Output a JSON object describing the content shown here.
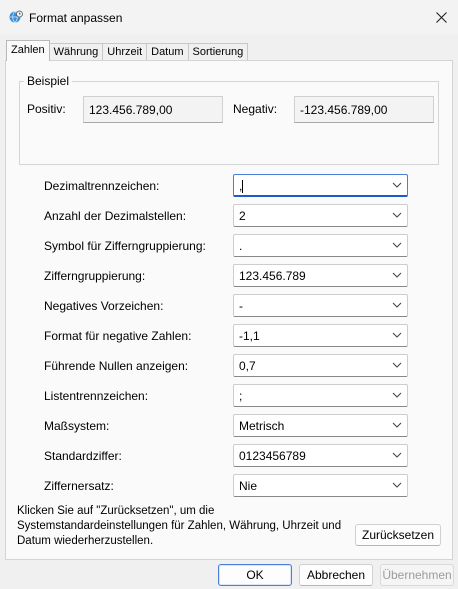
{
  "window": {
    "title": "Format anpassen",
    "title_icon": "globe-clock-icon",
    "close_icon": "close-icon"
  },
  "tabs": [
    {
      "label": "Zahlen",
      "active": true
    },
    {
      "label": "Währung",
      "active": false
    },
    {
      "label": "Uhrzeit",
      "active": false
    },
    {
      "label": "Datum",
      "active": false
    },
    {
      "label": "Sortierung",
      "active": false
    }
  ],
  "example": {
    "legend": "Beispiel",
    "positive_label": "Positiv:",
    "positive_value": "123.456.789,00",
    "negative_label": "Negativ:",
    "negative_value": "-123.456.789,00"
  },
  "settings": [
    {
      "label": "Dezimaltrennzeichen:",
      "value": ",",
      "focused": true
    },
    {
      "label": "Anzahl der Dezimalstellen:",
      "value": "2"
    },
    {
      "label": "Symbol für Zifferngruppierung:",
      "value": "."
    },
    {
      "label": "Zifferngruppierung:",
      "value": "123.456.789"
    },
    {
      "label": "Negatives Vorzeichen:",
      "value": "-"
    },
    {
      "label": "Format für negative Zahlen:",
      "value": "-1,1"
    },
    {
      "label": "Führende Nullen anzeigen:",
      "value": "0,7"
    },
    {
      "label": "Listentrennzeichen:",
      "value": ";"
    },
    {
      "label": "Maßsystem:",
      "value": "Metrisch"
    },
    {
      "label": "Standardziffer:",
      "value": "0123456789"
    },
    {
      "label": "Ziffernersatz:",
      "value": "Nie"
    }
  ],
  "reset_info": "Klicken Sie auf \"Zurücksetzen\", um die Systemstandardeinstellungen für Zahlen, Währung, Uhrzeit und Datum wiederherzustellen.",
  "buttons": {
    "reset": "Zurücksetzen",
    "ok": "OK",
    "cancel": "Abbrechen",
    "apply": "Übernehmen"
  },
  "colors": {
    "accent": "#1e5ac8",
    "window_bg": "#f0f0f0",
    "panel_bg": "#fafafa"
  }
}
